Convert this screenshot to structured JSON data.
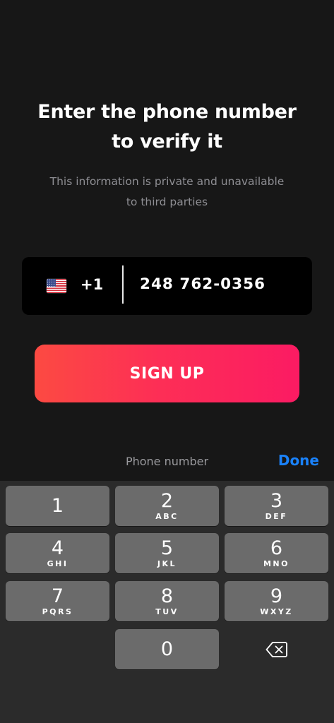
{
  "heading": {
    "line1": "Enter the phone number",
    "line2": "to verify it"
  },
  "subtitle": {
    "line1": "This information is private and unavailable",
    "line2": "to third parties"
  },
  "phone_input": {
    "country_flag": "us-flag-icon",
    "country_code": "+1",
    "value": "248 762-0356"
  },
  "signup_button": {
    "label": "SIGN UP"
  },
  "accessory_bar": {
    "label": "Phone number",
    "done_label": "Done"
  },
  "keypad": {
    "keys": [
      {
        "num": "1",
        "letters": ""
      },
      {
        "num": "2",
        "letters": "ABC"
      },
      {
        "num": "3",
        "letters": "DEF"
      },
      {
        "num": "4",
        "letters": "GHI"
      },
      {
        "num": "5",
        "letters": "JKL"
      },
      {
        "num": "6",
        "letters": "MNO"
      },
      {
        "num": "7",
        "letters": "PQRS"
      },
      {
        "num": "8",
        "letters": "TUV"
      },
      {
        "num": "9",
        "letters": "WXYZ"
      },
      {
        "num": "0",
        "letters": ""
      }
    ],
    "delete_icon": "backspace-icon"
  },
  "colors": {
    "background": "#171717",
    "button_gradient_start": "#fc4a42",
    "button_gradient_end": "#fb1b63",
    "done_blue": "#1a82fb",
    "key_bg": "#6b6b6b",
    "keyboard_bg": "#2b2b2b"
  }
}
